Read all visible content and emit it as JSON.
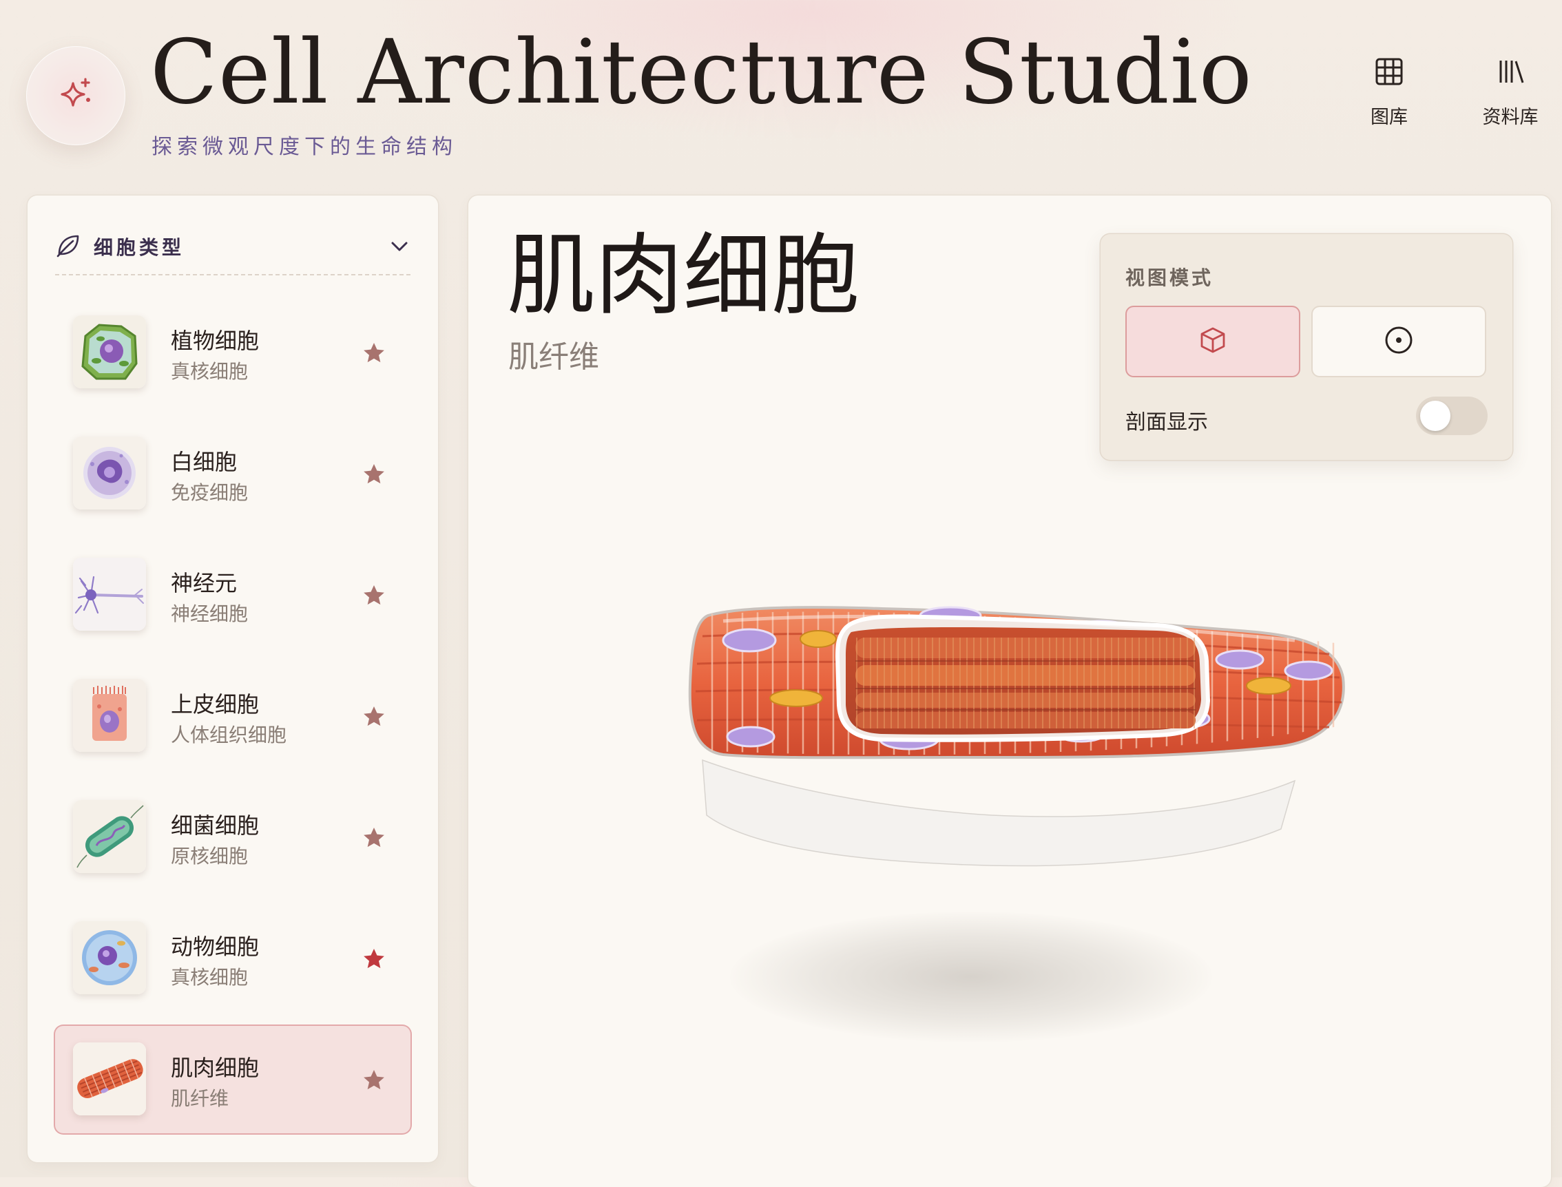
{
  "header": {
    "logo_icon": "sparkle-icon",
    "title": "Cell Architecture Studio",
    "subtitle": "探索微观尺度下的生命结构",
    "nav": [
      {
        "label": "图库",
        "icon": "grid-icon"
      },
      {
        "label": "资料库",
        "icon": "library-icon"
      }
    ]
  },
  "sidebar": {
    "header_label": "细胞类型",
    "header_icon": "leaf-icon",
    "items": [
      {
        "name": "植物细胞",
        "subtitle": "真核细胞",
        "favorite": false
      },
      {
        "name": "白细胞",
        "subtitle": "免疫细胞",
        "favorite": false
      },
      {
        "name": "神经元",
        "subtitle": "神经细胞",
        "favorite": false
      },
      {
        "name": "上皮细胞",
        "subtitle": "人体组织细胞",
        "favorite": false
      },
      {
        "name": "细菌细胞",
        "subtitle": "原核细胞",
        "favorite": false
      },
      {
        "name": "动物细胞",
        "subtitle": "真核细胞",
        "favorite": true
      },
      {
        "name": "肌肉细胞",
        "subtitle": "肌纤维",
        "favorite": false,
        "selected": true
      }
    ]
  },
  "main": {
    "title": "肌肉细胞",
    "subtitle": "肌纤维",
    "view_panel": {
      "title": "视图模式",
      "modes": [
        {
          "icon": "cube-icon",
          "active": true
        },
        {
          "icon": "target-icon",
          "active": false
        }
      ],
      "section_label": "剖面显示",
      "section_enabled": false
    }
  },
  "colors": {
    "accent": "#c24a4e",
    "accent_soft": "#f6dcdc",
    "star_default": "#a8736e",
    "star_favorite": "#c0393e",
    "subtitle_purple": "#6a5a94"
  }
}
